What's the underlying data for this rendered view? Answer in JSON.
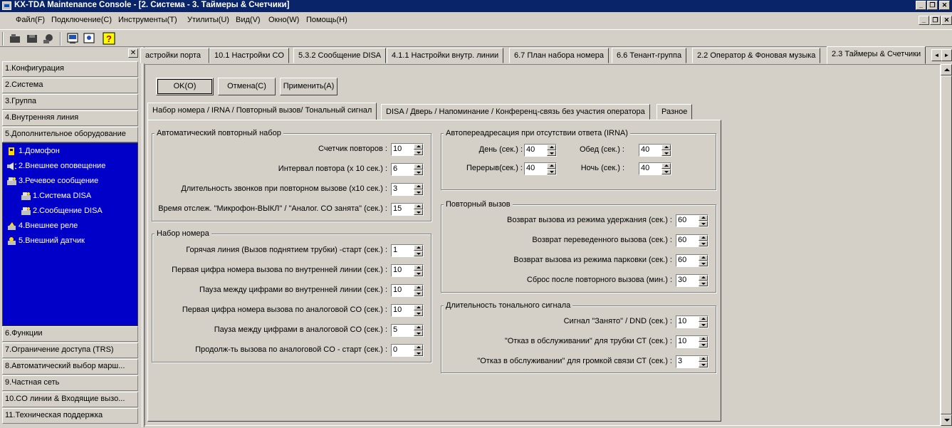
{
  "window": {
    "title": "KX-TDA Maintenance Console - [2. Система - 3. Таймеры & Счетчики]"
  },
  "menu": [
    "Файл(F)",
    "Подключение(C)",
    "Инструменты(T)",
    "Утилиты(U)",
    "Вид(V)",
    "Окно(W)",
    "Помощь(H)"
  ],
  "caption_buttons": {
    "minimize": "_",
    "restore": "❐",
    "close": "✕"
  },
  "toolbar_icons": [
    "disconnect-icon",
    "save-icon",
    "connect-icon",
    "system-info-icon",
    "report-icon",
    "help-icon"
  ],
  "left_nav": {
    "close_label": "✕",
    "top_items": [
      "1.Конфигурация",
      "2.Система",
      "3.Группа",
      "4.Внутренняя линия",
      "5.Дополнительное оборудование"
    ],
    "tree_items": [
      {
        "label": "1.Домофон",
        "icon": "doorphone-icon"
      },
      {
        "label": "2.Внешнее оповещение",
        "icon": "speaker-icon"
      },
      {
        "label": "3.Речевое сообщение",
        "icon": "voice-message-icon"
      },
      {
        "label": "1.Система DISA",
        "icon": "disa-system-icon"
      },
      {
        "label": "2.Сообщение DISA",
        "icon": "disa-message-icon"
      },
      {
        "label": "4.Внешнее реле",
        "icon": "relay-icon"
      },
      {
        "label": "5.Внешний датчик",
        "icon": "sensor-icon"
      }
    ],
    "bottom_items": [
      "6.Функции",
      "7.Ограничение доступа (TRS)",
      "8.Автоматический выбор марш...",
      "9.Частная сеть",
      "10.CO линии & Входящие вызо...",
      "11.Техническая поддержка"
    ]
  },
  "top_tabs": [
    "астройки порта",
    "10.1 Настройки CO",
    "5.3.2 Сообщение DISA",
    "4.1.1 Настройки внутр. линии",
    "6.7 План набора номера",
    "6.6 Тенант-группа",
    "2.2 Оператор & Фоновая музыка",
    "2.3 Таймеры & Счетчики"
  ],
  "tab_scroll": {
    "left": "◄",
    "right": "►"
  },
  "buttons": {
    "ok": "OK(O)",
    "cancel": "Отмена(C)",
    "apply": "Применить(A)"
  },
  "sub_tabs": [
    "Набор номера / IRNA / Повторный вызов/ Тональный сигнал",
    "DISA / Дверь / Напоминание / Конференц-связь без участия оператора",
    "Разное"
  ],
  "groups": {
    "auto_redial": {
      "title": "Автоматический повторный набор",
      "fields": [
        {
          "label": "Счетчик повторов :",
          "value": "10"
        },
        {
          "label": "Интервал повтора (x 10 сек.) :",
          "value": "6"
        },
        {
          "label": "Длительность звонков при повторном вызове (x10 сек.) :",
          "value": "3"
        },
        {
          "label": "Время отслеж. \"Микрофон-ВЫКЛ\" / \"Аналог. CO занята\" (сек.) :",
          "value": "15"
        }
      ]
    },
    "dialing": {
      "title": "Набор номера",
      "fields": [
        {
          "label": "Горячая линия (Вызов поднятием трубки) -старт (сек.) :",
          "value": "1"
        },
        {
          "label": "Первая цифра номера вызова по внутренней линии (сек.) :",
          "value": "10"
        },
        {
          "label": "Пауза между цифрами во внутренней линии (сек.) :",
          "value": "10"
        },
        {
          "label": "Первая цифра номера вызова по аналоговой CO (сек.) :",
          "value": "10"
        },
        {
          "label": "Пауза между цифрами в аналоговой CO (сек.) :",
          "value": "5"
        },
        {
          "label": "Продолж-ть вызова по аналоговой CO - старт (сек.) :",
          "value": "0"
        }
      ]
    },
    "irna": {
      "title": "Автопереадресация при отсутствии ответа (IRNA)",
      "fields": [
        {
          "label": "День (сек.) :",
          "value": "40"
        },
        {
          "label": "Обед (сек.) :",
          "value": "40"
        },
        {
          "label": "Перерыв(сек.) :",
          "value": "40"
        },
        {
          "label": "Ночь (сек.) :",
          "value": "40"
        }
      ]
    },
    "recall": {
      "title": "Повторный вызов",
      "fields": [
        {
          "label": "Возврат вызова из режима удержания (сек.) :",
          "value": "60"
        },
        {
          "label": "Возврат переведенного вызова (сек.) :",
          "value": "60"
        },
        {
          "label": "Возврат вызова из режима парковки (сек.) :",
          "value": "60"
        },
        {
          "label": "Сброс после повторного вызова (мин.) :",
          "value": "30"
        }
      ]
    },
    "tone": {
      "title": "Длительность тонального сигнала",
      "fields": [
        {
          "label": "Сигнал \"Занято\" / DND (сек.) :",
          "value": "10"
        },
        {
          "label": "\"Отказ в обслуживании\" для трубки СТ (сек.) :",
          "value": "10"
        },
        {
          "label": "\"Отказ в обслуживании\" для громкой связи СТ (сек.) :",
          "value": "3"
        }
      ]
    }
  }
}
